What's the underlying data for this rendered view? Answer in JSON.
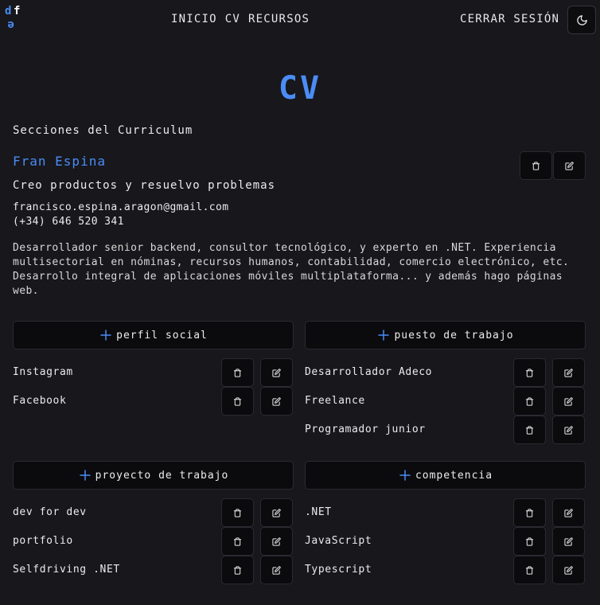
{
  "brand": {
    "letter_d": "d",
    "letter_f": "f",
    "letter_e": "e"
  },
  "nav": {
    "items": [
      "INICIO",
      "CV",
      "RECURSOS"
    ],
    "logout": "CERRAR SESIÓN"
  },
  "icons": {
    "theme": "moon-icon",
    "delete": "trash-icon",
    "edit": "edit-icon",
    "add": "plus-icon"
  },
  "colors": {
    "accent": "#4b8cf5",
    "background": "#17171c",
    "button_bg": "#0b0b0e"
  },
  "page": {
    "title": "CV",
    "sections_title": "Secciones del Curriculum"
  },
  "profile": {
    "name": "Fran Espina",
    "headline": "Creo productos y resuelvo problemas",
    "email": "francisco.espina.aragon@gmail.com",
    "phone": "(+34) 646 520 341",
    "summary": "Desarrollador senior backend, consultor tecnológico, y experto en .NET. Experiencia multisectorial en nóminas, recursos humanos, contabilidad, comercio electrónico, etc. Desarrollo integral de aplicaciones móviles multiplataforma... y además hago páginas web."
  },
  "sections": [
    {
      "add_label": "perfil social",
      "items": [
        "Instagram",
        "Facebook"
      ]
    },
    {
      "add_label": "puesto de trabajo",
      "items": [
        "Desarrollador Adeco",
        "Freelance",
        "Programador junior"
      ]
    },
    {
      "add_label": "proyecto de trabajo",
      "items": [
        "dev for dev",
        "portfolio",
        "Selfdriving .NET"
      ]
    },
    {
      "add_label": "competencia",
      "items": [
        ".NET",
        "JavaScript",
        "Typescript"
      ]
    }
  ]
}
